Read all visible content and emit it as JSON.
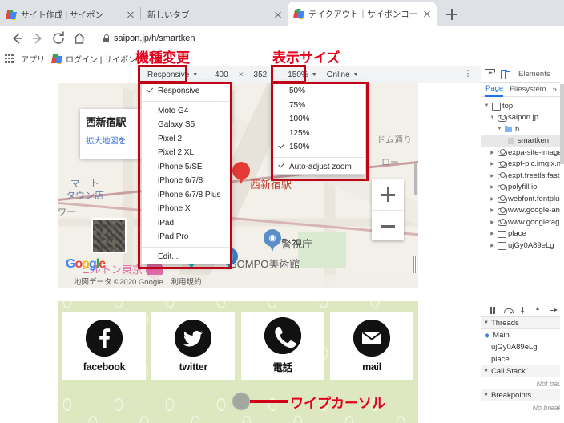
{
  "browser": {
    "tabs": [
      {
        "title": "サイト作成 | サイポン",
        "active": false,
        "favicon": "saipon-icon"
      },
      {
        "title": "新しいタブ",
        "active": false,
        "favicon": "none"
      },
      {
        "title": "テイクアウト｜サイポンコーヒー（スマホ",
        "active": true,
        "favicon": "saipon-icon"
      }
    ],
    "new_tab_label": "+",
    "nav": {
      "back": "←",
      "forward": "→",
      "reload": "C",
      "home": "⌂"
    },
    "omnibox": {
      "url": "saipon.jp/h/smartken",
      "lock": "lock-icon"
    },
    "bookmarks": [
      {
        "label": "アプリ",
        "icon": "apps-grid-icon"
      },
      {
        "label": "ログイン | サイポン",
        "icon": "saipon-icon"
      }
    ]
  },
  "annotations": {
    "device_change": "機種変更",
    "display_size": "表示サイズ",
    "wipe_cursor": "ワイプカーソル"
  },
  "device_toolbar": {
    "device": "Responsive",
    "width": "400",
    "times": "×",
    "height": "352",
    "zoom": "150%",
    "network": "Online",
    "more": "⋮"
  },
  "device_menu": {
    "selected": "Responsive",
    "items": [
      "Responsive",
      "Moto G4",
      "Galaxy S5",
      "Pixel 2",
      "Pixel 2 XL",
      "iPhone 5/SE",
      "iPhone 6/7/8",
      "iPhone 6/7/8 Plus",
      "iPhone X",
      "iPad",
      "iPad Pro"
    ],
    "edit": "Edit..."
  },
  "zoom_menu": {
    "items": [
      "50%",
      "75%",
      "100%",
      "125%",
      "150%"
    ],
    "selected": "150%",
    "auto": "Auto-adjust zoom",
    "auto_checked": true
  },
  "page": {
    "map": {
      "infowindow_title": "西新宿駅",
      "infowindow_link": "拡大地図を",
      "labels": [
        {
          "text": "ーマート",
          "color": "#6b7fa8"
        },
        {
          "text": "タウン店",
          "color": "#6b7fa8"
        },
        {
          "text": "ヒルトン東京",
          "color": "#e06aa8"
        },
        {
          "text": "西新宿駅",
          "color": "#c0392b"
        },
        {
          "text": "ワー",
          "color": "#7a7a7a"
        },
        {
          "text": "警視庁",
          "color": "#444444"
        },
        {
          "text": "SOMPO美術館",
          "color": "#5a5a5a"
        },
        {
          "text": "ドム通り",
          "color": "#8a8a8a"
        },
        {
          "text": "ロー",
          "color": "#8a8a8a"
        }
      ],
      "logo": "Google",
      "attribution": "地図データ ©2020 Google",
      "terms": "利用規約",
      "zoom_in": "+",
      "zoom_out": "−"
    },
    "social_buttons": [
      {
        "label": "facebook",
        "icon": "facebook-icon",
        "glyph": "f"
      },
      {
        "label": "twitter",
        "icon": "twitter-icon",
        "glyph": "🐦"
      },
      {
        "label": "電話",
        "icon": "phone-icon",
        "glyph": "✆"
      },
      {
        "label": "mail",
        "icon": "mail-icon",
        "glyph": "✉"
      }
    ]
  },
  "devtools": {
    "tab": "Elements",
    "icons": {
      "inspect": "inspect-icon",
      "device": "device-toolbar-icon"
    },
    "subtabs": [
      {
        "label": "Page",
        "selected": true
      },
      {
        "label": "Filesystem",
        "selected": false
      },
      {
        "label": "»",
        "selected": false
      }
    ],
    "tree": [
      {
        "label": "top",
        "depth": 0,
        "icon": "frame-icon",
        "expanded": true,
        "selected": false
      },
      {
        "label": "saipon.jp",
        "depth": 1,
        "icon": "cloud-icon",
        "expanded": true,
        "selected": false
      },
      {
        "label": "h",
        "depth": 2,
        "icon": "folder-icon",
        "expanded": true,
        "selected": false
      },
      {
        "label": "smartken",
        "depth": 3,
        "icon": "file-icon",
        "expanded": false,
        "selected": true
      },
      {
        "label": "expa-site-image.",
        "depth": 1,
        "icon": "cloud-icon",
        "expanded": false,
        "selected": false
      },
      {
        "label": "expt-pic.imgix.ne",
        "depth": 1,
        "icon": "cloud-icon",
        "expanded": false,
        "selected": false
      },
      {
        "label": "expt.freetls.fastly.",
        "depth": 1,
        "icon": "cloud-icon",
        "expanded": false,
        "selected": false
      },
      {
        "label": "polyfill.io",
        "depth": 1,
        "icon": "cloud-icon",
        "expanded": false,
        "selected": false
      },
      {
        "label": "webfont.fontplus",
        "depth": 1,
        "icon": "cloud-icon",
        "expanded": false,
        "selected": false
      },
      {
        "label": "www.google-ana",
        "depth": 1,
        "icon": "cloud-icon",
        "expanded": false,
        "selected": false
      },
      {
        "label": "www.googletagm",
        "depth": 1,
        "icon": "cloud-icon",
        "expanded": false,
        "selected": false
      },
      {
        "label": "place",
        "depth": 1,
        "icon": "frame-icon",
        "expanded": false,
        "selected": false
      },
      {
        "label": "ujGy0A89eLg",
        "depth": 1,
        "icon": "frame-icon",
        "expanded": false,
        "selected": false
      }
    ],
    "debugger": {
      "buttons": [
        "pause-icon",
        "step-over-icon",
        "step-into-icon",
        "step-out-icon",
        "step-icon"
      ],
      "threads_header": "Threads",
      "threads": [
        {
          "label": "Main",
          "current": true
        },
        {
          "label": "ujGy0A89eLg",
          "current": false
        },
        {
          "label": "place",
          "current": false
        }
      ],
      "callstack_header": "Call Stack",
      "callstack_empty": "Not pau",
      "breakpoints_header": "Breakpoints",
      "breakpoints_empty": "No break"
    }
  },
  "colors": {
    "annotation_red": "#d40017",
    "devtools_blue": "#1a73e8",
    "page_green": "#dde8c0"
  }
}
